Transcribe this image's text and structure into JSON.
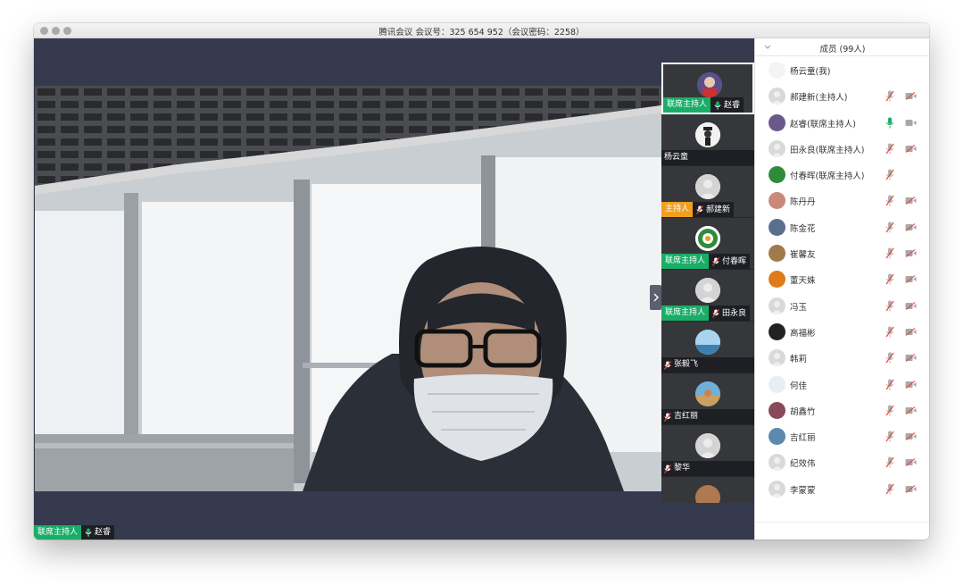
{
  "window": {
    "title": "腾讯会议 会议号：325 654 952（会议密码：2258）"
  },
  "main_video": {
    "role_tag": "联席主持人",
    "speaker_name": "赵睿"
  },
  "video_strip": [
    {
      "name": "赵睿",
      "role": "联席主持人",
      "role_color": "#1aad67",
      "mic": "on",
      "selected": true,
      "avatar_icon": "photo-avatar-icon"
    },
    {
      "name": "杨云童",
      "role": "",
      "mic": "none",
      "selected": false,
      "avatar_icon": "photo-avatar-icon"
    },
    {
      "name": "郝建新",
      "role": "主持人",
      "role_color": "#f0a020",
      "mic": "muted",
      "selected": false,
      "avatar_icon": "default-avatar-icon"
    },
    {
      "name": "付春晖",
      "role": "联席主持人",
      "role_color": "#1aad67",
      "mic": "muted",
      "selected": false,
      "avatar_icon": "logo-avatar-icon"
    },
    {
      "name": "田永良",
      "role": "联席主持人",
      "role_color": "#1aad67",
      "mic": "muted",
      "selected": false,
      "avatar_icon": "default-avatar-icon"
    },
    {
      "name": "张毅飞",
      "role": "",
      "mic": "muted",
      "selected": false,
      "avatar_icon": "photo-avatar-icon"
    },
    {
      "name": "吉红丽",
      "role": "",
      "mic": "muted",
      "selected": false,
      "avatar_icon": "photo-avatar-icon"
    },
    {
      "name": "黎华",
      "role": "",
      "mic": "muted",
      "selected": false,
      "avatar_icon": "default-avatar-icon"
    },
    {
      "name": "",
      "role": "",
      "mic": "none",
      "selected": false,
      "avatar_icon": "photo-avatar-icon"
    }
  ],
  "members_panel": {
    "title": "成员 (99人)",
    "members": [
      {
        "name": "杨云童(我)",
        "mic": "none",
        "cam": "none",
        "avatar_color": "#f4f4f4"
      },
      {
        "name": "郝建新(主持人)",
        "mic": "muted",
        "cam": "off",
        "avatar_color": "#d9d9d9"
      },
      {
        "name": "赵睿(联席主持人)",
        "mic": "on",
        "cam": "on",
        "avatar_color": "#6a5a8a"
      },
      {
        "name": "田永良(联席主持人)",
        "mic": "muted",
        "cam": "off",
        "avatar_color": "#d9d9d9"
      },
      {
        "name": "付春晖(联席主持人)",
        "mic": "muted",
        "cam": "none",
        "avatar_color": "#2e8b3a"
      },
      {
        "name": "陈丹丹",
        "mic": "muted",
        "cam": "off",
        "avatar_color": "#c98a7a"
      },
      {
        "name": "陈金花",
        "mic": "muted",
        "cam": "off",
        "avatar_color": "#5a6e8e"
      },
      {
        "name": "崔馨友",
        "mic": "muted",
        "cam": "off",
        "avatar_color": "#a07a4a"
      },
      {
        "name": "董天姝",
        "mic": "muted",
        "cam": "off",
        "avatar_color": "#e07a1a"
      },
      {
        "name": "冯玉",
        "mic": "muted",
        "cam": "off",
        "avatar_color": "#d9d9d9"
      },
      {
        "name": "高福彬",
        "mic": "muted",
        "cam": "off",
        "avatar_color": "#222222"
      },
      {
        "name": "韩莉",
        "mic": "muted",
        "cam": "off",
        "avatar_color": "#d9d9d9"
      },
      {
        "name": "何佳",
        "mic": "muted",
        "cam": "off",
        "avatar_color": "#e8eef2"
      },
      {
        "name": "胡鑫竹",
        "mic": "muted",
        "cam": "off",
        "avatar_color": "#8a4a5a"
      },
      {
        "name": "吉红丽",
        "mic": "muted",
        "cam": "off",
        "avatar_color": "#5a8ab0"
      },
      {
        "name": "纪效伟",
        "mic": "muted",
        "cam": "off",
        "avatar_color": "#d9d9d9"
      },
      {
        "name": "李蒙蒙",
        "mic": "muted",
        "cam": "off",
        "avatar_color": "#d9d9d9"
      }
    ]
  },
  "colors": {
    "accent_green": "#1aad67",
    "host_orange": "#f0a020",
    "muted_red": "#e0473a",
    "video_bg": "#363a4e"
  }
}
